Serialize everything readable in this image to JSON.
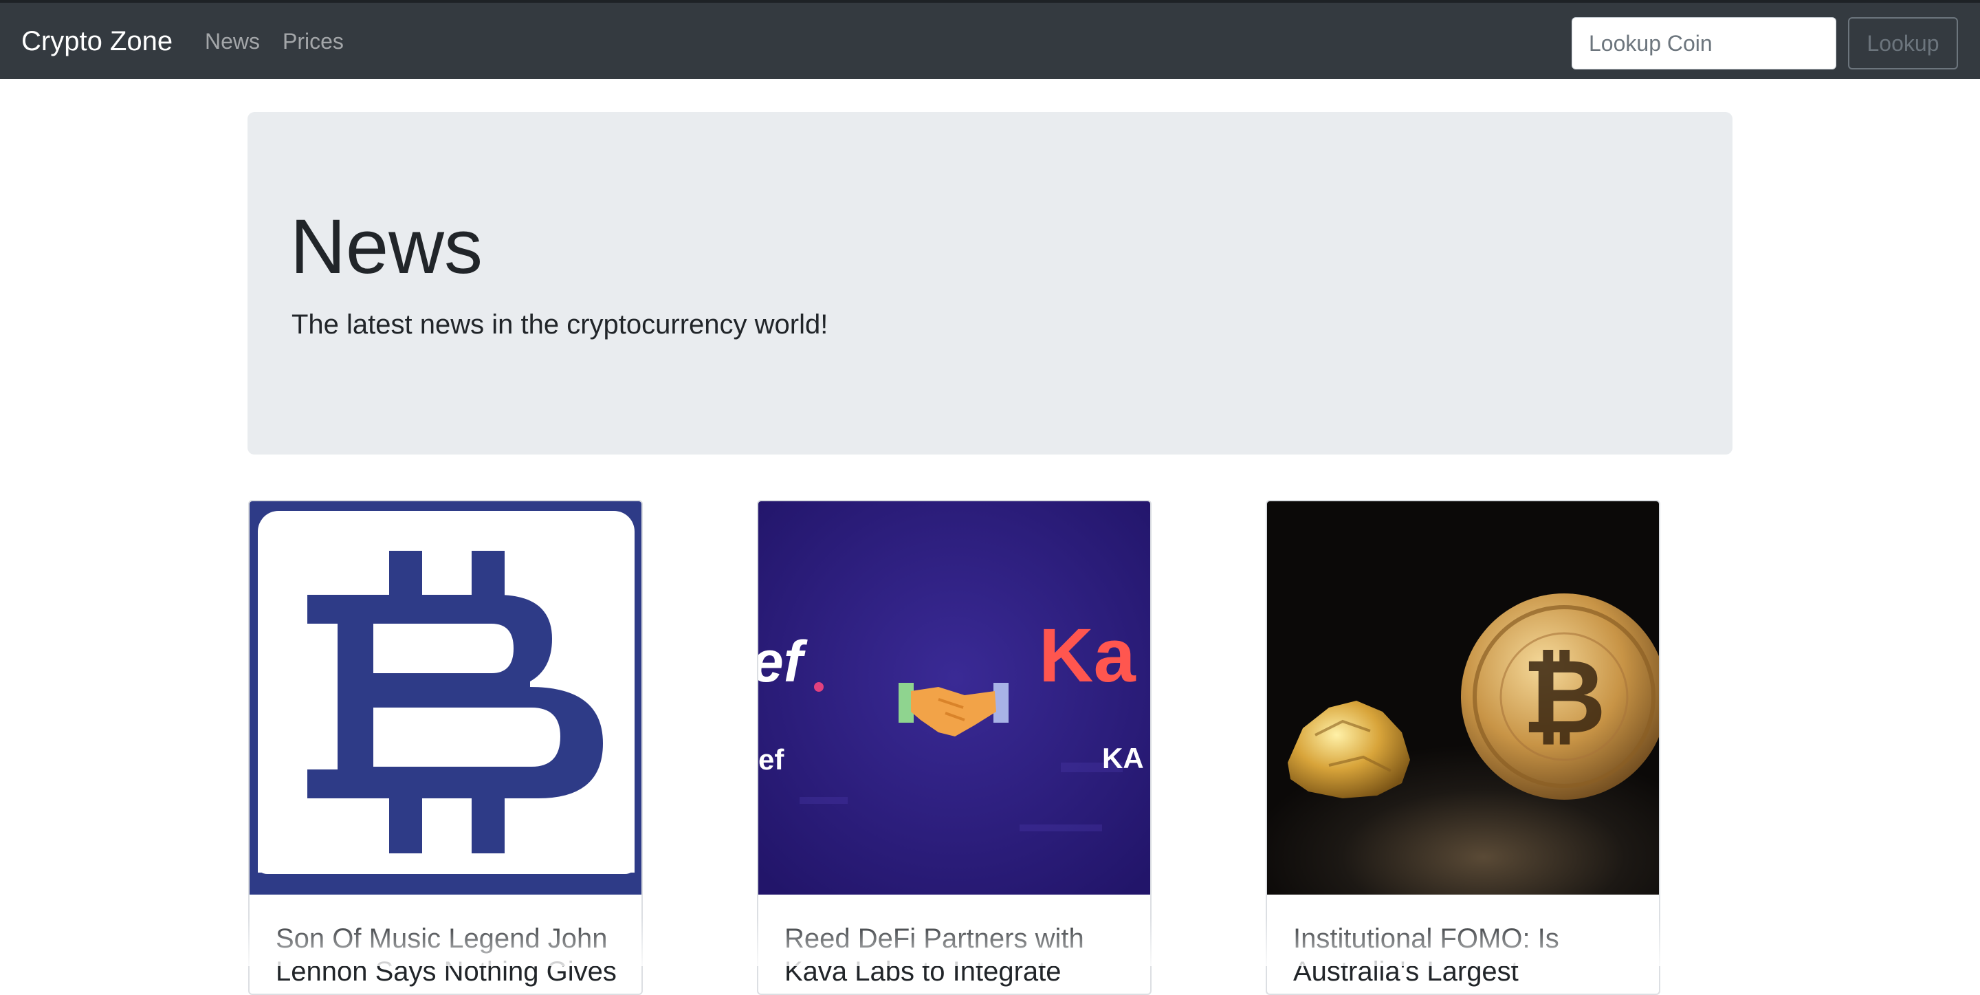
{
  "navbar": {
    "brand": "Crypto Zone",
    "links": [
      {
        "label": "News"
      },
      {
        "label": "Prices"
      }
    ],
    "search": {
      "placeholder": "Lookup Coin",
      "value": ""
    },
    "lookup_button": "Lookup"
  },
  "hero": {
    "title": "News",
    "subtitle": "The latest news in the cryptocurrency world!"
  },
  "articles": [
    {
      "title": "Son Of Music Legend John Lennon Says Nothing Gives",
      "image_icon": "bitcoin-logo-icon"
    },
    {
      "title": "Reed DeFi Partners with Kava Labs to Integrate",
      "image_icon": "handshake-icon",
      "image_text_left": "ef",
      "image_text_left_small": "ef",
      "image_text_right": "Ka",
      "image_text_right_small": "KA"
    },
    {
      "title": "Institutional FOMO: Is Australia's Largest",
      "image_icon": "gold-bitcoin-icon",
      "image_coin_symbol": "₿"
    }
  ],
  "colors": {
    "navbar_bg": "#343a40",
    "jumbotron_bg": "#e9ecef",
    "bitcoin_blue": "#2e3b87",
    "kava_purple": "#2d1c7a",
    "kava_red": "#ff564f"
  }
}
